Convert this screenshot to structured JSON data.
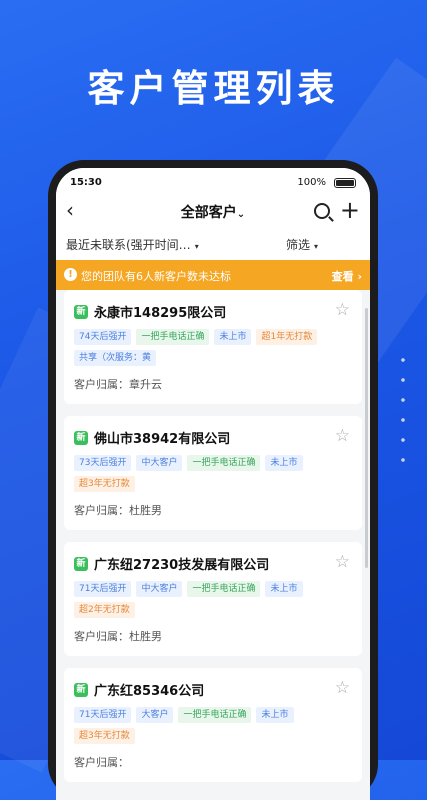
{
  "headline": "客户管理列表",
  "status_bar": {
    "time": "15:30",
    "battery": "100%"
  },
  "navbar": {
    "title": "全部客户",
    "title_caret": "⌄"
  },
  "filters": {
    "left": "最近未联系(强开时间…",
    "right": "筛选",
    "arrow": "▾"
  },
  "banner": {
    "icon": "!",
    "text": "您的团队有6人新客户数未达标",
    "action": "查看 ›"
  },
  "owner_label": "客户归属：",
  "customers": [
    {
      "badge": "新",
      "name": "永康市148295限公司",
      "tags": [
        {
          "text": "74天后强开",
          "color": "blue"
        },
        {
          "text": "一把手电话正确",
          "color": "green"
        },
        {
          "text": "未上市",
          "color": "blue"
        },
        {
          "text": "超1年无打款",
          "color": "orange"
        },
        {
          "text": "共享（次服务：黄",
          "color": "blue"
        }
      ],
      "owner": "章升云"
    },
    {
      "badge": "新",
      "name": "佛山市38942有限公司",
      "tags": [
        {
          "text": "73天后强开",
          "color": "blue"
        },
        {
          "text": "中大客户",
          "color": "blue"
        },
        {
          "text": "一把手电话正确",
          "color": "green"
        },
        {
          "text": "未上市",
          "color": "blue"
        },
        {
          "text": "超3年无打款",
          "color": "orange"
        }
      ],
      "owner": "杜胜男"
    },
    {
      "badge": "新",
      "name": "广东纽27230技发展有限公司",
      "tags": [
        {
          "text": "71天后强开",
          "color": "blue"
        },
        {
          "text": "中大客户",
          "color": "blue"
        },
        {
          "text": "一把手电话正确",
          "color": "green"
        },
        {
          "text": "未上市",
          "color": "blue"
        },
        {
          "text": "超2年无打款",
          "color": "orange"
        }
      ],
      "owner": "杜胜男"
    },
    {
      "badge": "新",
      "name": "广东红85346公司",
      "tags": [
        {
          "text": "71天后强开",
          "color": "blue"
        },
        {
          "text": "大客户",
          "color": "blue"
        },
        {
          "text": "一把手电话正确",
          "color": "green"
        },
        {
          "text": "未上市",
          "color": "blue"
        },
        {
          "text": "超3年无打款",
          "color": "orange"
        }
      ],
      "owner": ""
    }
  ],
  "colors": {
    "banner": "#f5a623",
    "new_badge": "#3bbf5c",
    "brand_bg": "#1b57e6"
  },
  "icons": [
    "back-arrow-icon",
    "search-icon",
    "plus-icon",
    "star-icon",
    "info-icon",
    "battery-icon"
  ]
}
